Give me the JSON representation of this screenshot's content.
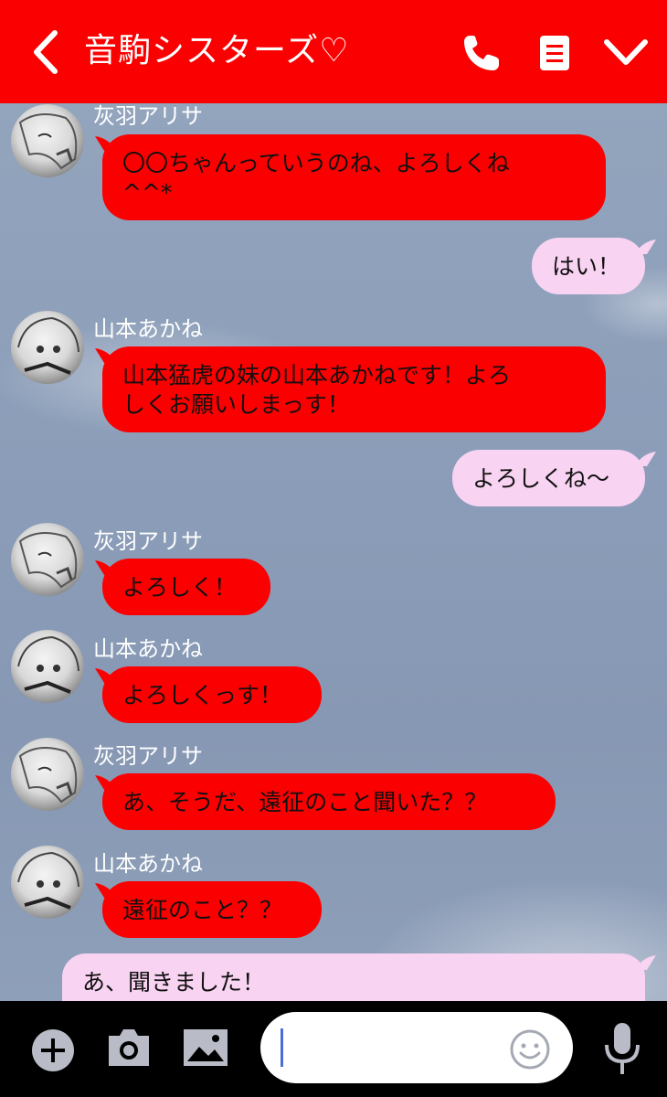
{
  "header": {
    "title": "音駒シスターズ♡",
    "back_icon": "chevron-left-icon",
    "call_icon": "phone-icon",
    "notes_icon": "note-icon",
    "menu_icon": "chevron-down-icon",
    "bg_color": "#fb0000"
  },
  "colors": {
    "incoming_bubble": "#fb0000",
    "outgoing_bubble": "#f9d3f2"
  },
  "messages": [
    {
      "sender": "灰羽アリサ",
      "text": "〇〇ちゃんっていうのね、よろしくね\n^^*",
      "side": "left"
    },
    {
      "text": "はい！",
      "side": "right"
    },
    {
      "sender": "山本あかね",
      "text": "山本猛虎の妹の山本あかねです！よろ\nしくお願いしまっす！",
      "side": "left"
    },
    {
      "text": "よろしくね〜",
      "side": "right"
    },
    {
      "sender": "灰羽アリサ",
      "text": "よろしく！",
      "side": "left"
    },
    {
      "sender": "山本あかね",
      "text": "よろしくっす！",
      "side": "left"
    },
    {
      "sender": "灰羽アリサ",
      "text": "あ、そうだ、遠征のこと聞いた？？",
      "side": "left"
    },
    {
      "sender": "山本あかね",
      "text": "遠征のこと？？",
      "side": "left"
    },
    {
      "text": "あ、聞きました！",
      "side": "right"
    }
  ],
  "input": {
    "add_icon": "plus-icon",
    "camera_icon": "camera-icon",
    "image_icon": "image-icon",
    "emoji_icon": "smiley-icon",
    "mic_icon": "microphone-icon",
    "value": ""
  }
}
